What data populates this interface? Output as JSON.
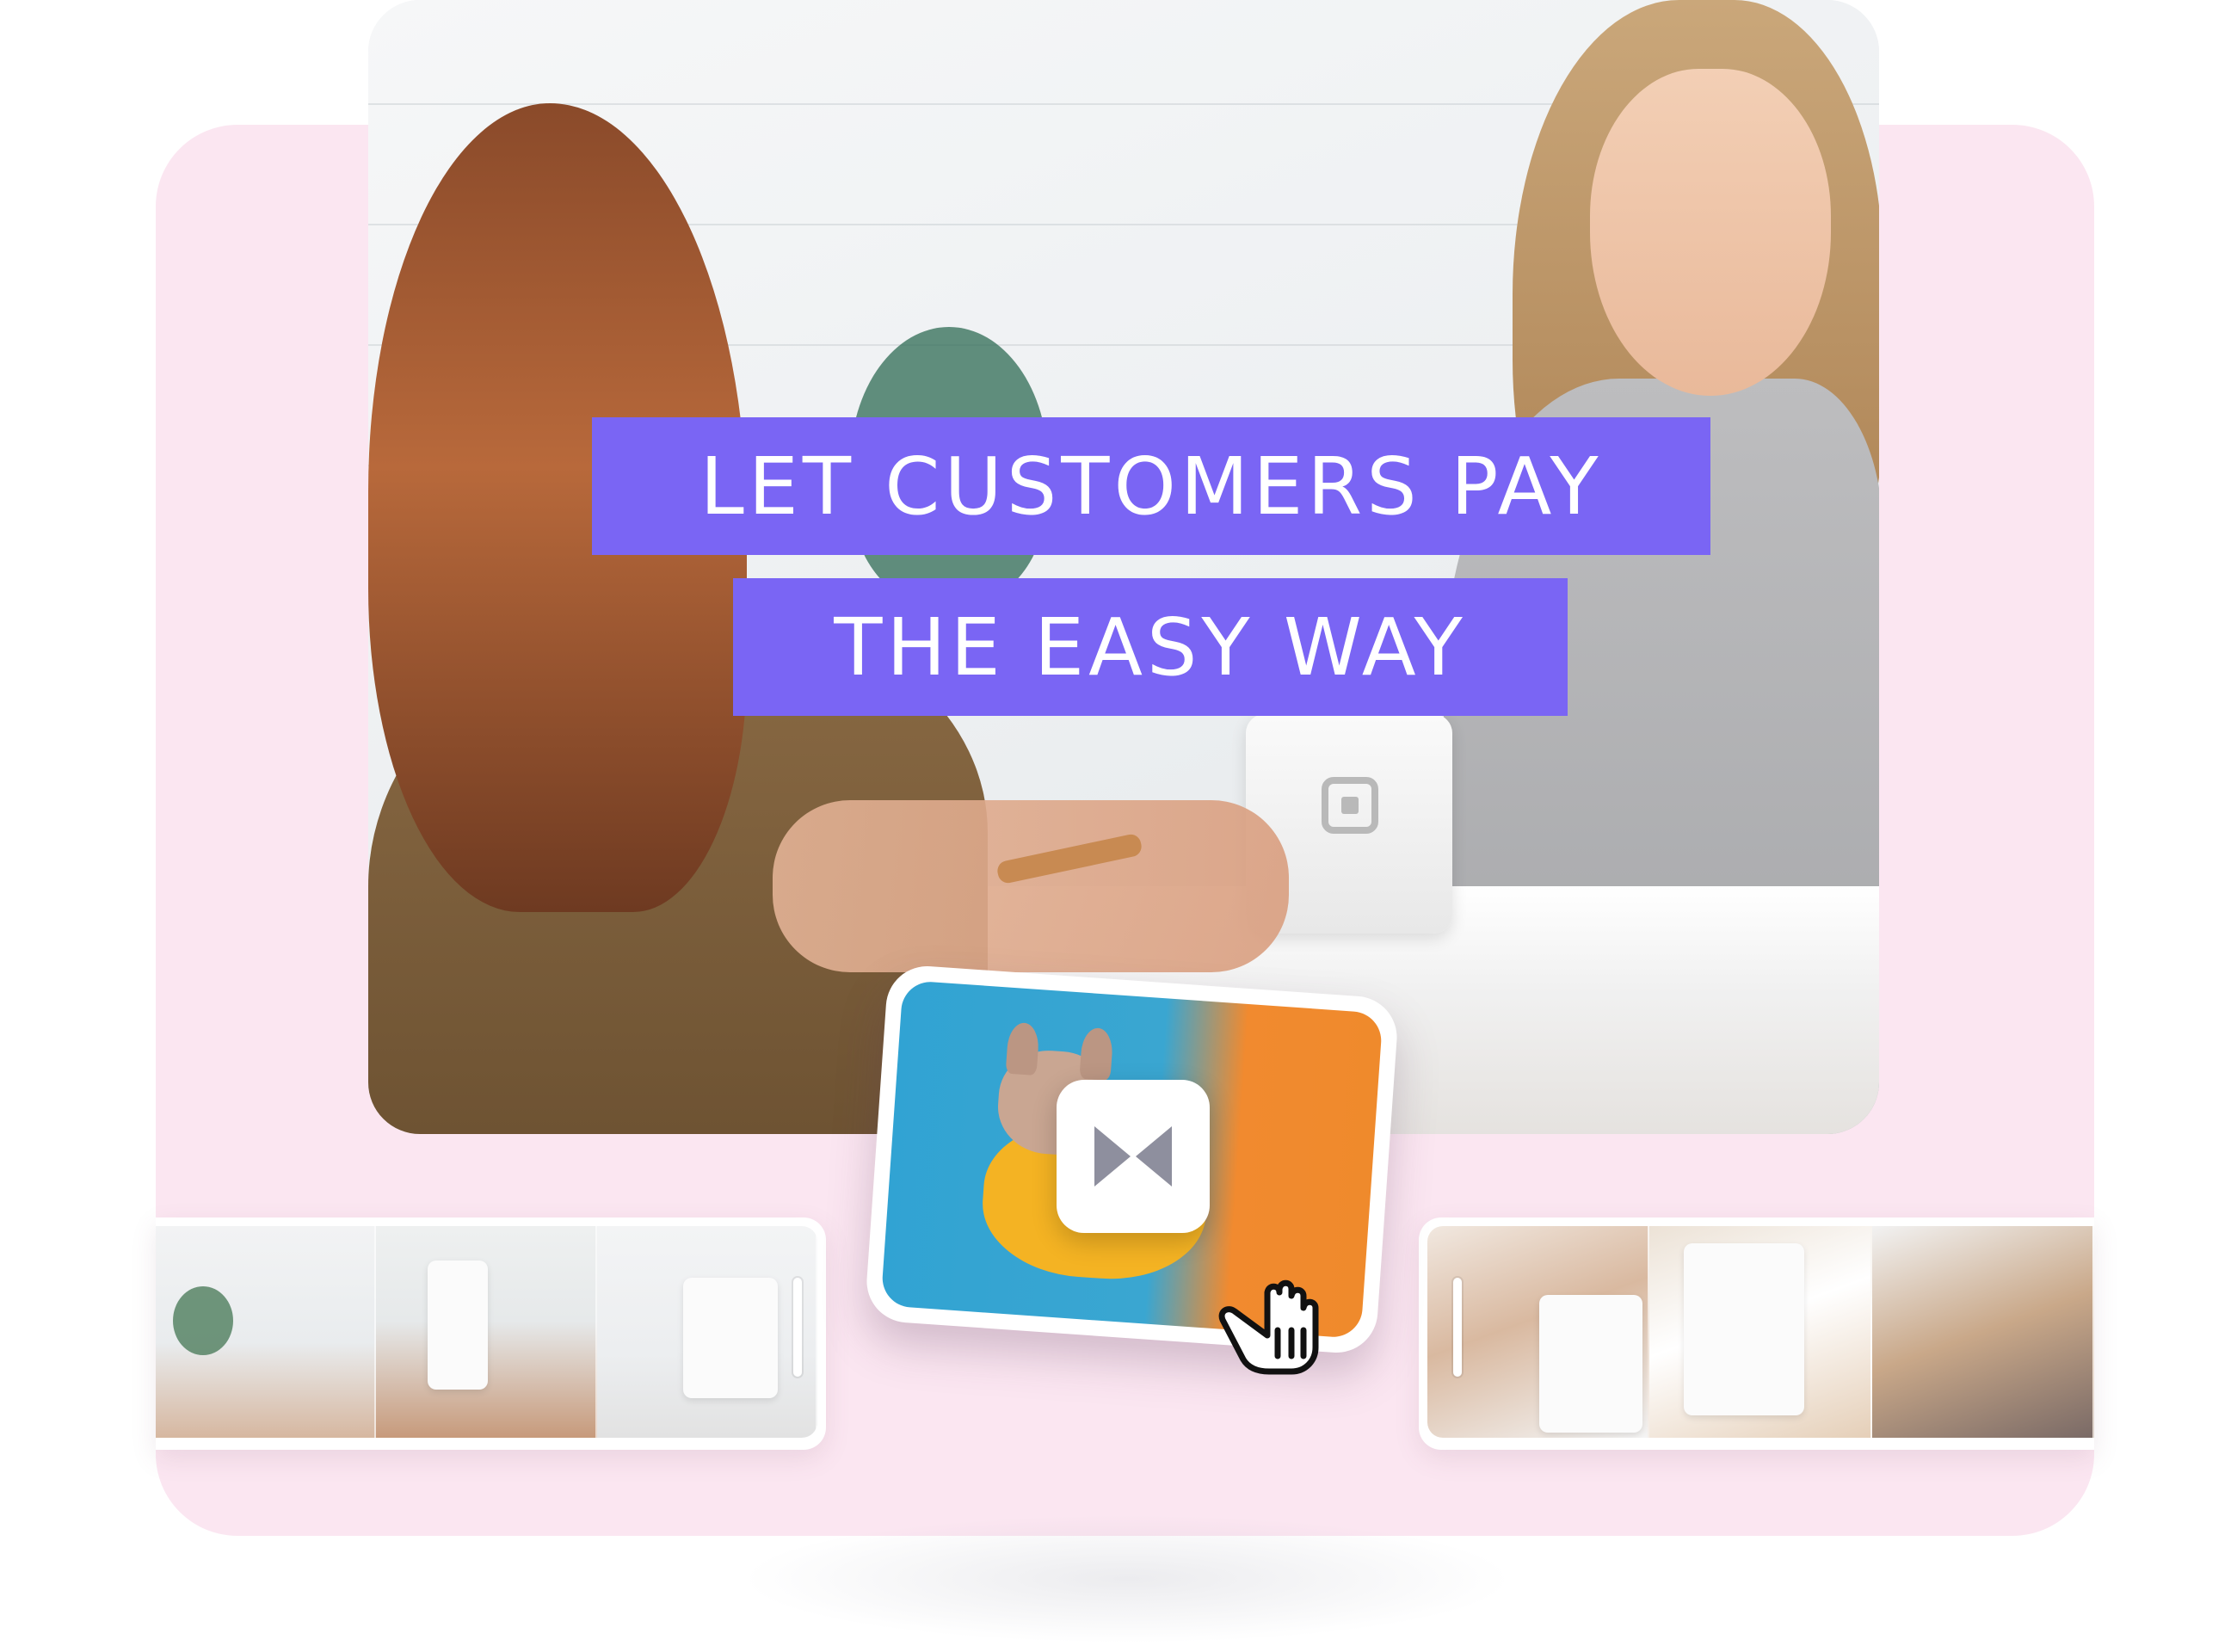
{
  "headline": {
    "line1": "LET CUSTOMERS PAY",
    "line2": "THE EASY WAY"
  },
  "colors": {
    "stage_background": "#fbe6f1",
    "title_bar": "#7a65f4",
    "title_text": "#ffffff"
  },
  "icons": {
    "transition": "bowtie-transition-icon",
    "cursor": "grab-hand-cursor-icon",
    "pos_logo": "square-logo-icon"
  }
}
